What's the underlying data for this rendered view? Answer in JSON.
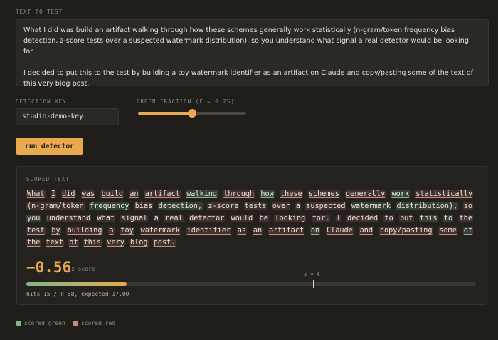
{
  "input": {
    "label": "TEXT TO TEST",
    "paragraphs": [
      "What I did was build an artifact walking through how these schemes generally work statistically (n-gram/token frequency bias detection, z-score tests over a suspected watermark distribution), so you understand what signal a real detector would be looking for.",
      "I decided to put this to the test by building a toy watermark identifier as an artifact on Claude and copy/pasting some of the text of this very blog post."
    ]
  },
  "detection_key": {
    "label": "DETECTION KEY",
    "value": "studio-demo-key"
  },
  "green_fraction": {
    "label": "GREEN FRACTION (Γ = 0.25)",
    "value": 0.25,
    "slider_min": 0,
    "slider_max": 0.5
  },
  "run_button": {
    "label": "run detector"
  },
  "scored": {
    "label": "SCORED TEXT",
    "tokens": [
      {
        "t": "What",
        "g": false
      },
      {
        "t": "I",
        "g": false
      },
      {
        "t": "did",
        "g": false
      },
      {
        "t": "was",
        "g": false
      },
      {
        "t": "build",
        "g": false
      },
      {
        "t": "an",
        "g": false
      },
      {
        "t": "artifact",
        "g": false
      },
      {
        "t": "walking",
        "g": true
      },
      {
        "t": "through",
        "g": false
      },
      {
        "t": "how",
        "g": true
      },
      {
        "t": "these",
        "g": false
      },
      {
        "t": "schemes",
        "g": false
      },
      {
        "t": "generally",
        "g": false
      },
      {
        "t": "work",
        "g": true
      },
      {
        "t": "statistically",
        "g": false
      },
      {
        "t": "(n-gram/token",
        "g": false
      },
      {
        "t": "frequency",
        "g": true
      },
      {
        "t": "bias",
        "g": false
      },
      {
        "t": "detection,",
        "g": true
      },
      {
        "t": "z-score",
        "g": false
      },
      {
        "t": "tests",
        "g": false
      },
      {
        "t": "over",
        "g": false
      },
      {
        "t": "a",
        "g": false
      },
      {
        "t": "suspected",
        "g": false
      },
      {
        "t": "watermark",
        "g": true
      },
      {
        "t": "distribution),",
        "g": true
      },
      {
        "t": "so",
        "g": false
      },
      {
        "t": "you",
        "g": true
      },
      {
        "t": "understand",
        "g": false
      },
      {
        "t": "what",
        "g": false
      },
      {
        "t": "signal",
        "g": false
      },
      {
        "t": "a",
        "g": false
      },
      {
        "t": "real",
        "g": false
      },
      {
        "t": "detector",
        "g": false
      },
      {
        "t": "would",
        "g": false
      },
      {
        "t": "be",
        "g": false
      },
      {
        "t": "looking",
        "g": false
      },
      {
        "t": "for.",
        "g": false
      },
      {
        "t": "I",
        "g": false
      },
      {
        "t": "decided",
        "g": false
      },
      {
        "t": "to",
        "g": false
      },
      {
        "t": "put",
        "g": false
      },
      {
        "t": "this",
        "g": true
      },
      {
        "t": "to",
        "g": true
      },
      {
        "t": "the",
        "g": false
      },
      {
        "t": "test",
        "g": false
      },
      {
        "t": "by",
        "g": false
      },
      {
        "t": "building",
        "g": false
      },
      {
        "t": "a",
        "g": false
      },
      {
        "t": "toy",
        "g": false
      },
      {
        "t": "watermark",
        "g": false
      },
      {
        "t": "identifier",
        "g": false
      },
      {
        "t": "as",
        "g": false
      },
      {
        "t": "an",
        "g": false
      },
      {
        "t": "artifact",
        "g": false
      },
      {
        "t": "on",
        "g": true
      },
      {
        "t": "Claude",
        "g": false
      },
      {
        "t": "and",
        "g": false
      },
      {
        "t": "copy/pasting",
        "g": false
      },
      {
        "t": "some",
        "g": false
      },
      {
        "t": "of",
        "g": true
      },
      {
        "t": "the",
        "g": false
      },
      {
        "t": "text",
        "g": false
      },
      {
        "t": "of",
        "g": false
      },
      {
        "t": "this",
        "g": false
      },
      {
        "t": "very",
        "g": false
      },
      {
        "t": "blog",
        "g": false
      },
      {
        "t": "post.",
        "g": false
      }
    ]
  },
  "result": {
    "z_value": "−0.56",
    "z_label": "z-score",
    "threshold_label": "z = 4",
    "threshold_fraction": 0.638,
    "fill_fraction": 0.223,
    "stats": "hits 15 / n 68, expected 17.00"
  },
  "legend": {
    "green_label": "scored green",
    "red_label": "scored red"
  },
  "colors": {
    "accent": "#e8a94f",
    "green": "#7fb88a",
    "red": "#c98a80",
    "background": "#1f1e1b"
  }
}
